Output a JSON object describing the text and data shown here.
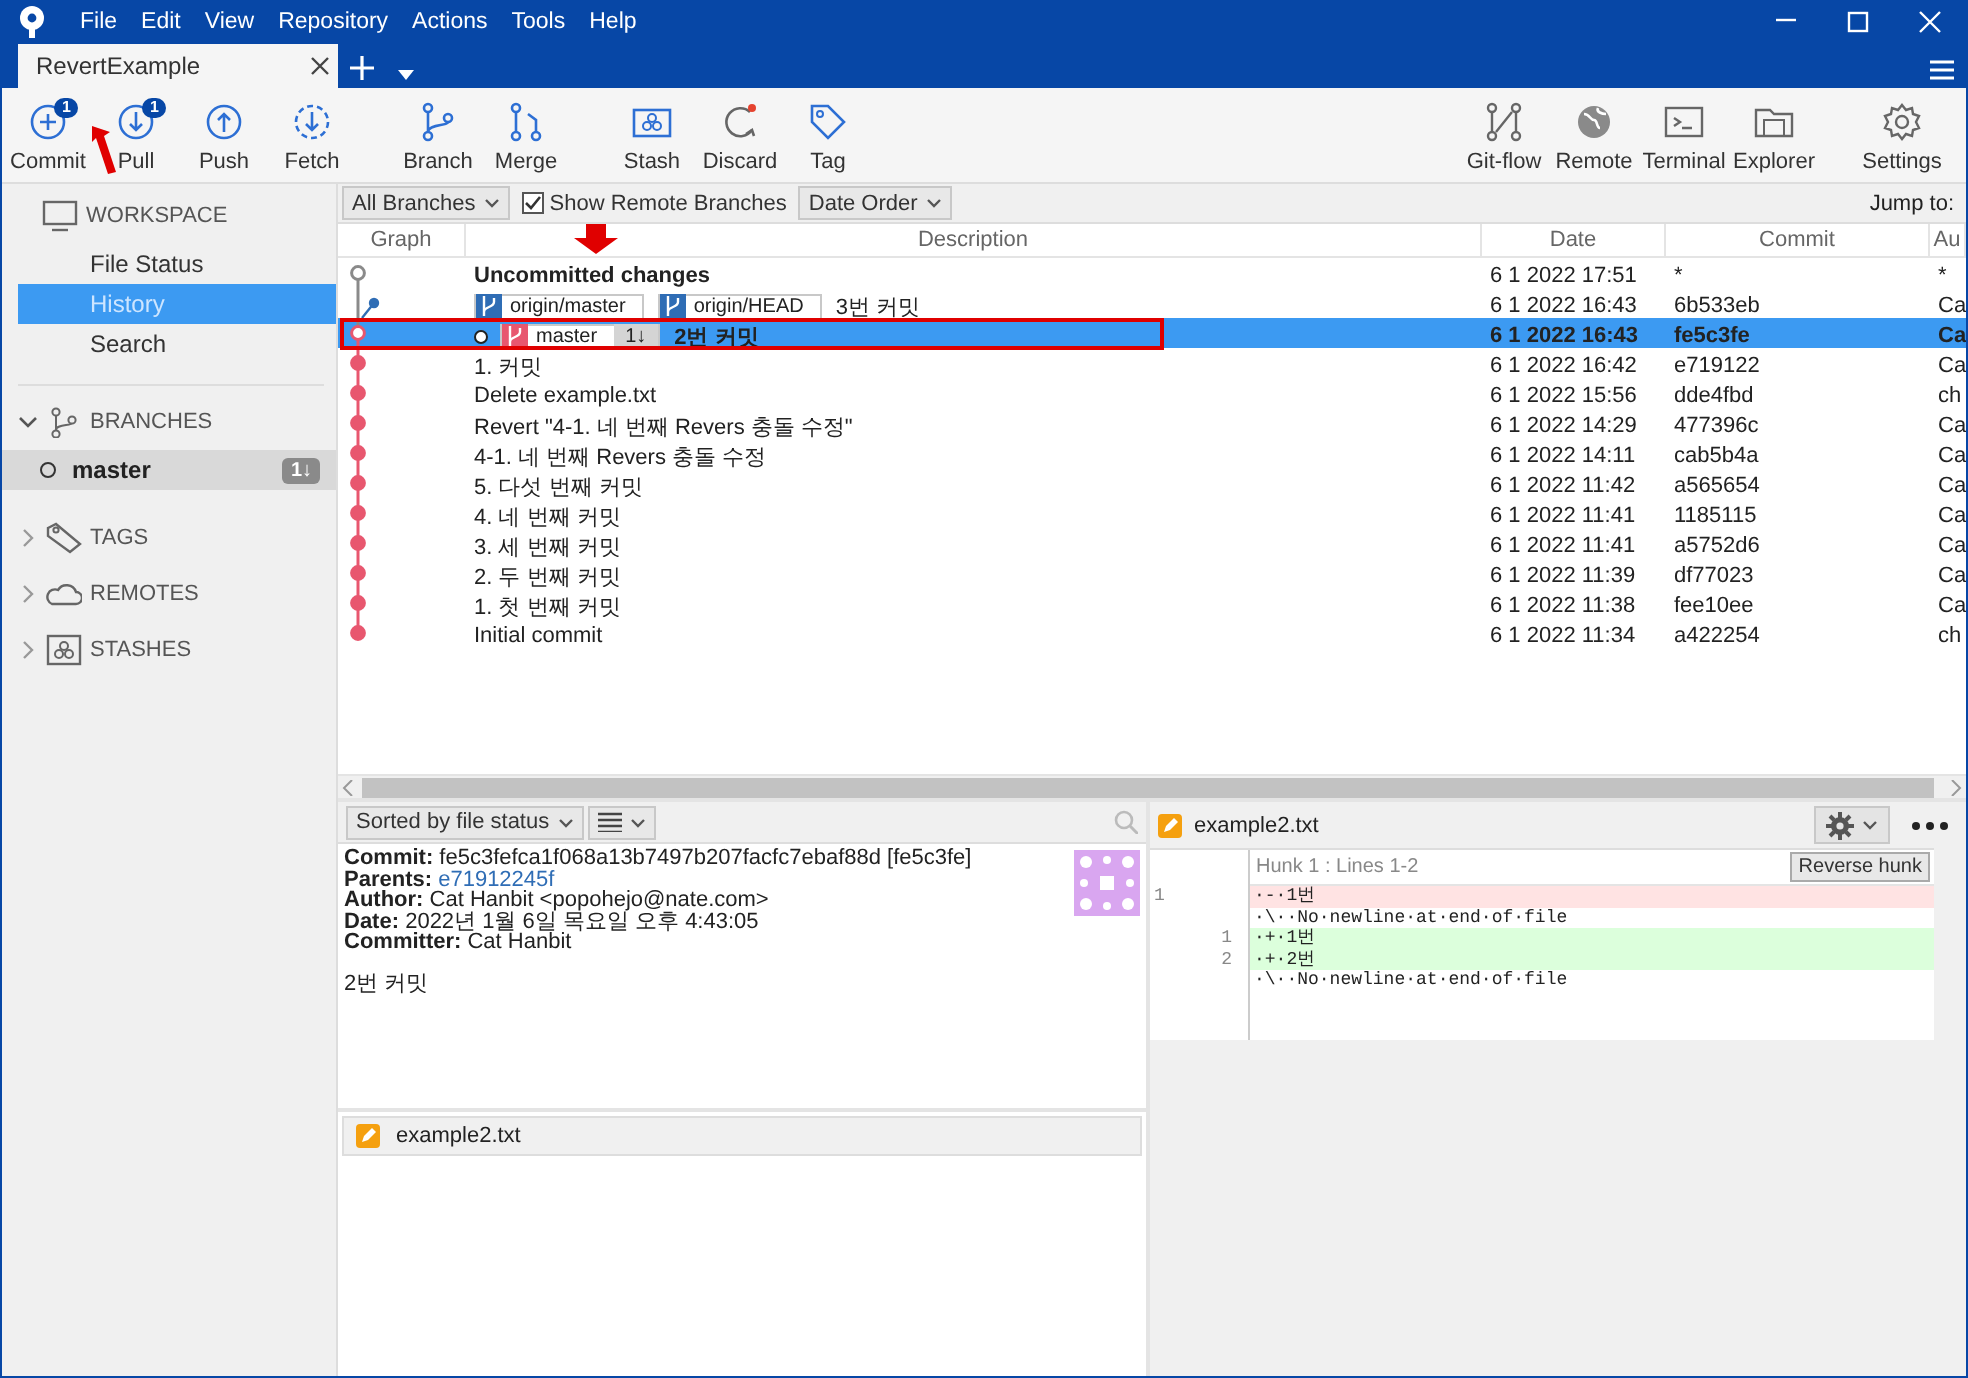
{
  "window": {
    "menu": [
      "File",
      "Edit",
      "View",
      "Repository",
      "Actions",
      "Tools",
      "Help"
    ],
    "tab": {
      "title": "RevertExample",
      "selected": true
    }
  },
  "toolbar": {
    "left": [
      {
        "label": "Commit",
        "kind": "plus",
        "badge": "1"
      },
      {
        "label": "Pull",
        "kind": "down",
        "badge": "1"
      },
      {
        "label": "Push",
        "kind": "up"
      },
      {
        "label": "Fetch",
        "kind": "fetch"
      },
      {
        "label": "Branch",
        "kind": "branch"
      },
      {
        "label": "Merge",
        "kind": "merge"
      },
      {
        "label": "Stash",
        "kind": "stash"
      },
      {
        "label": "Discard",
        "kind": "discard"
      },
      {
        "label": "Tag",
        "kind": "tag"
      }
    ],
    "right": [
      {
        "label": "Git-flow",
        "kind": "gitflow"
      },
      {
        "label": "Remote",
        "kind": "globe"
      },
      {
        "label": "Terminal",
        "kind": "terminal"
      },
      {
        "label": "Explorer",
        "kind": "folder"
      },
      {
        "label": "Settings",
        "kind": "gear"
      }
    ]
  },
  "sidebar": {
    "sections": [
      {
        "kind": "workspace",
        "title": "WORKSPACE",
        "items": [
          {
            "label": "File Status",
            "selected": false
          },
          {
            "label": "History",
            "selected": true
          },
          {
            "label": "Search",
            "selected": false
          }
        ]
      },
      {
        "kind": "branches",
        "title": "BRANCHES",
        "expanded": true,
        "items": [
          {
            "label": "master",
            "current": true,
            "badge": "1↓",
            "selected": true
          }
        ]
      },
      {
        "kind": "tags",
        "title": "TAGS",
        "expanded": false
      },
      {
        "kind": "remotes",
        "title": "REMOTES",
        "expanded": false
      },
      {
        "kind": "stashes",
        "title": "STASHES",
        "expanded": false
      }
    ]
  },
  "filter": {
    "branches": "All Branches",
    "show_remote": {
      "label": "Show Remote Branches",
      "checked": true
    },
    "order": "Date Order",
    "jump_to": "Jump to:"
  },
  "commits": {
    "columns": [
      "Graph",
      "Description",
      "Date",
      "Commit",
      "Au"
    ],
    "rows": [
      {
        "kind": "uncommitted",
        "color": "#8a8a8a",
        "description": "Uncommitted changes",
        "date": "6 1 2022 17:51",
        "commit": "*",
        "author": "*",
        "selected": false
      },
      {
        "kind": "remote",
        "color": "#2f6db5",
        "refs": [
          {
            "name": "origin/master"
          },
          {
            "name": "origin/HEAD"
          }
        ],
        "description": "3번 커밋",
        "date": "6 1 2022 16:43",
        "commit": "6b533eb",
        "author": "Ca",
        "selected": false
      },
      {
        "kind": "head",
        "color": "#e8576f",
        "refs": [
          {
            "name": "master",
            "count": "1↓"
          }
        ],
        "description": "2번 커밋",
        "date": "6 1 2022 16:43",
        "commit": "fe5c3fe",
        "author": "Ca",
        "selected": true
      },
      {
        "kind": "commit",
        "color": "#e8576f",
        "description": "1. 커밋",
        "date": "6 1 2022 16:42",
        "commit": "e719122",
        "author": "Ca",
        "selected": false
      },
      {
        "kind": "commit",
        "color": "#e8576f",
        "description": "Delete example.txt",
        "date": "6 1 2022 15:56",
        "commit": "dde4fbd",
        "author": "ch",
        "selected": false
      },
      {
        "kind": "commit",
        "color": "#e8576f",
        "description": "Revert \"4-1. 네 번째 Revers 충돌 수정\"",
        "date": "6 1 2022 14:29",
        "commit": "477396c",
        "author": "Ca",
        "selected": false
      },
      {
        "kind": "commit",
        "color": "#e8576f",
        "description": "4-1. 네 번째 Revers 충돌 수정",
        "date": "6 1 2022 14:11",
        "commit": "cab5b4a",
        "author": "Ca",
        "selected": false
      },
      {
        "kind": "commit",
        "color": "#e8576f",
        "description": "5. 다섯 번째 커밋",
        "date": "6 1 2022 11:42",
        "commit": "a565654",
        "author": "Ca",
        "selected": false
      },
      {
        "kind": "commit",
        "color": "#e8576f",
        "description": "4. 네 번째 커밋",
        "date": "6 1 2022 11:41",
        "commit": "1185115",
        "author": "Ca",
        "selected": false
      },
      {
        "kind": "commit",
        "color": "#e8576f",
        "description": "3. 세 번째 커밋",
        "date": "6 1 2022 11:41",
        "commit": "a5752d6",
        "author": "Ca",
        "selected": false
      },
      {
        "kind": "commit",
        "color": "#e8576f",
        "description": "2. 두 번째 커밋",
        "date": "6 1 2022 11:39",
        "commit": "df77023",
        "author": "Ca",
        "selected": false
      },
      {
        "kind": "commit",
        "color": "#e8576f",
        "description": "1. 첫 번째 커밋",
        "date": "6 1 2022 11:38",
        "commit": "fee10ee",
        "author": "Ca",
        "selected": false
      },
      {
        "kind": "commit",
        "color": "#e8576f",
        "description": "Initial commit",
        "date": "6 1 2022 11:34",
        "commit": "a422254",
        "author": "ch",
        "selected": false
      }
    ]
  },
  "details": {
    "sort": "Sorted by file status",
    "fields": [
      {
        "label": "Commit:",
        "value": "fe5c3fefca1f068a13b7497b207facfc7ebaf88d [fe5c3fe]",
        "kind": "text"
      },
      {
        "label": "Parents:",
        "value": "e71912245f",
        "kind": "link"
      },
      {
        "label": "Author:",
        "value": "Cat Hanbit <popohejo@nate.com>",
        "kind": "text"
      },
      {
        "label": "Date:",
        "value": "2022년 1월 6일 목요일 오후 4:43:05",
        "kind": "text"
      },
      {
        "label": "Committer:",
        "value": "Cat Hanbit",
        "kind": "text"
      }
    ],
    "message": "2번 커밋",
    "files": [
      {
        "name": "example2.txt",
        "kind": "modified"
      }
    ]
  },
  "diff": {
    "file": "example2.txt",
    "kind": "modified",
    "hunk": "Hunk 1 : Lines 1-2",
    "action": "Reverse hunk",
    "lines": [
      {
        "kind": "removed",
        "old": "1",
        "text": "·-·1번"
      },
      {
        "kind": "context",
        "text": "·\\··No·newline·at·end·of·file"
      },
      {
        "kind": "added",
        "new": "1",
        "text": "·+·1번"
      },
      {
        "kind": "added",
        "new": "2",
        "text": "·+·2번"
      },
      {
        "kind": "context",
        "text": "·\\··No·newline·at·end·of·file"
      }
    ]
  }
}
